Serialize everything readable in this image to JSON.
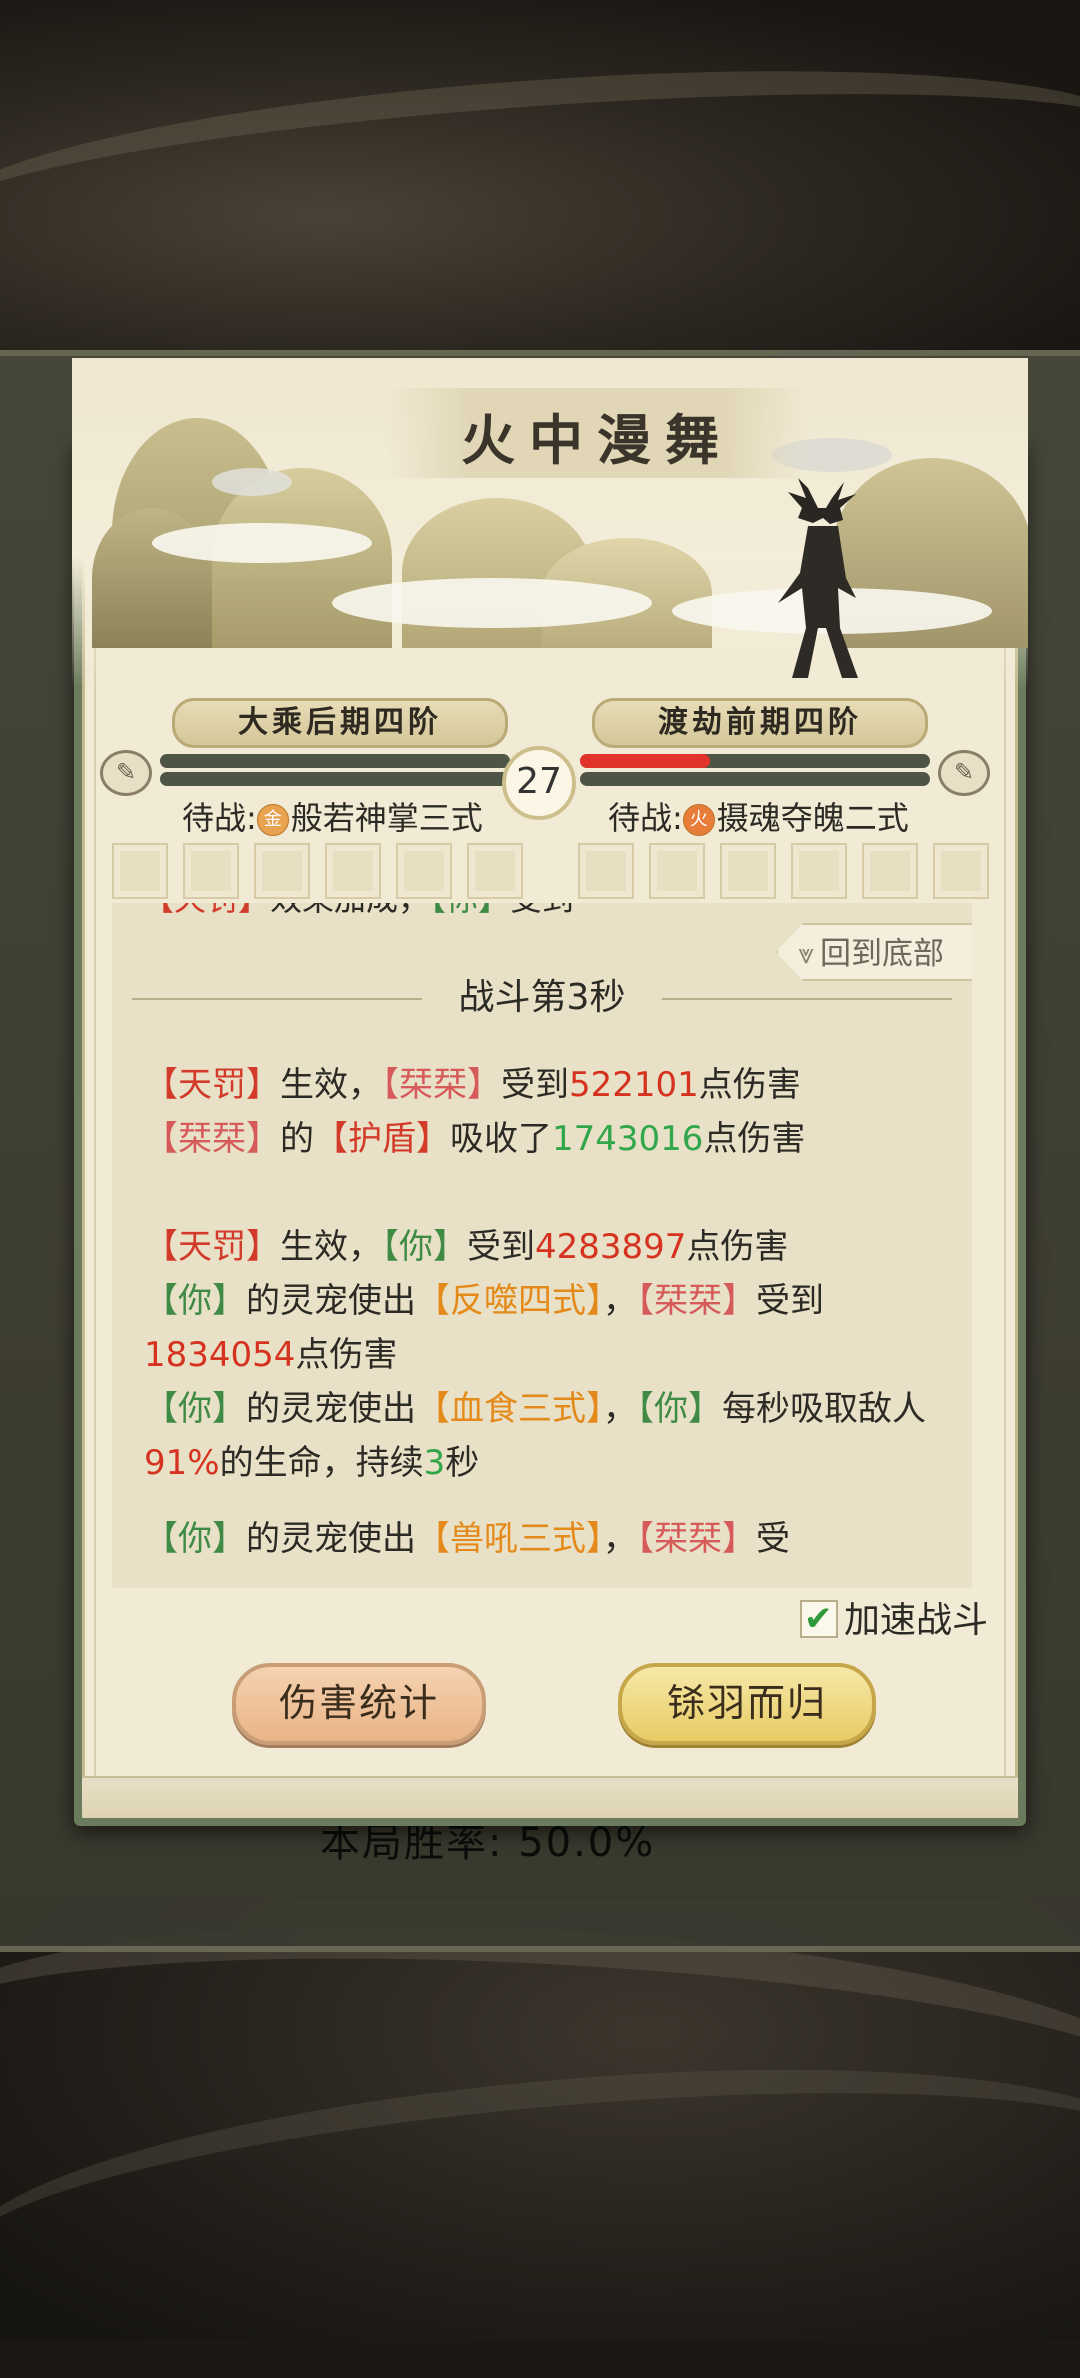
{
  "battle": {
    "title": "火中漫舞",
    "timer": "27",
    "player": {
      "rank": "大乘后期四阶",
      "waiting_label": "待战:",
      "element": "金",
      "skill": "般若神掌三式",
      "hp_fraction": 0.0,
      "shield_fraction": 0.0
    },
    "enemy": {
      "rank": "渡劫前期四阶",
      "waiting_label": "待战:",
      "element": "火",
      "skill": "摄魂夺魄二式",
      "hp_fraction": 0.37,
      "shield_fraction": 0.0
    },
    "slot_count_each": 6
  },
  "log": {
    "back_to_bottom": "回到底部",
    "section_title": "战斗第3秒",
    "lines": [
      {
        "parts": [
          [
            "【天罚】",
            "red"
          ],
          [
            "生效，",
            ""
          ],
          [
            "【栞栞】",
            "pink"
          ],
          [
            "受到",
            ""
          ],
          [
            "522101",
            "numred"
          ],
          [
            "点伤害",
            ""
          ]
        ]
      },
      {
        "parts": [
          [
            "【栞栞】",
            "pink"
          ],
          [
            "的",
            ""
          ],
          [
            "【护盾】",
            "red"
          ],
          [
            "吸收了",
            ""
          ],
          [
            "1743016",
            "numgreen"
          ],
          [
            "点伤害",
            ""
          ]
        ]
      },
      {
        "gap": true
      },
      {
        "parts": [
          [
            "【天罚】",
            "red"
          ],
          [
            "生效，",
            ""
          ],
          [
            "【你】",
            "green"
          ],
          [
            "受到",
            ""
          ],
          [
            "4283897",
            "numred"
          ],
          [
            "点伤害",
            ""
          ]
        ]
      },
      {
        "parts": [
          [
            "【你】",
            "green"
          ],
          [
            "的灵宠使出",
            ""
          ],
          [
            "【反噬四式】",
            "orange"
          ],
          [
            "，",
            ""
          ],
          [
            "【栞栞】",
            "pink"
          ],
          [
            "受到",
            ""
          ],
          [
            "1834054",
            "numred"
          ],
          [
            "点伤害",
            ""
          ]
        ]
      },
      {
        "parts": [
          [
            "【你】",
            "green"
          ],
          [
            "的灵宠使出",
            ""
          ],
          [
            "【血食三式】",
            "orange"
          ],
          [
            "，",
            ""
          ],
          [
            "【你】",
            "green"
          ],
          [
            "每秒吸取敌人",
            ""
          ],
          [
            "91%",
            "numred"
          ],
          [
            "的生命，持续",
            ""
          ],
          [
            "3",
            "numgreen"
          ],
          [
            "秒",
            ""
          ]
        ]
      },
      {
        "small_gap": true
      },
      {
        "parts": [
          [
            "【你】",
            "green"
          ],
          [
            "的灵宠使出",
            ""
          ],
          [
            "【兽吼三式】",
            "orange"
          ],
          [
            "，",
            ""
          ],
          [
            "【栞栞】",
            "pink"
          ],
          [
            "受",
            ""
          ]
        ]
      }
    ]
  },
  "controls": {
    "speed_label": "加速战斗",
    "speed_checked": true,
    "stats_button": "伤害统计",
    "return_button": "铩羽而归"
  },
  "background": {
    "win_rate_text": "本局胜率: 50.0%"
  },
  "colors": {
    "red": "#d23b2a",
    "pink": "#d65a5a",
    "green": "#3f8a45",
    "orange": "#e38a1a",
    "numred": "#d5331f",
    "numgreen": "#31a64a",
    "enemy_hp": "#e2332a"
  }
}
